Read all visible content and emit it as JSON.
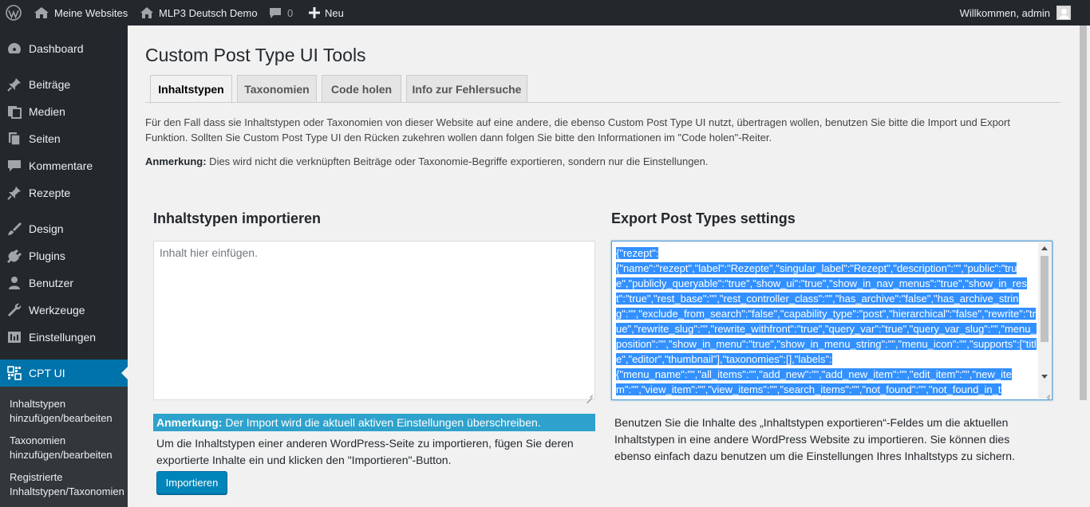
{
  "adminbar": {
    "my_sites": "Meine Websites",
    "site_name": "MLP3 Deutsch Demo",
    "comments_count": "0",
    "new_label": "Neu",
    "greeting": "Willkommen, admin"
  },
  "sidebar": {
    "items": [
      {
        "label": "Dashboard",
        "icon": "dashboard-icon"
      },
      {
        "label": "Beiträge",
        "icon": "pin-icon"
      },
      {
        "label": "Medien",
        "icon": "media-icon"
      },
      {
        "label": "Seiten",
        "icon": "pages-icon"
      },
      {
        "label": "Kommentare",
        "icon": "comment-icon"
      },
      {
        "label": "Rezepte",
        "icon": "pin-icon"
      },
      {
        "label": "Design",
        "icon": "brush-icon"
      },
      {
        "label": "Plugins",
        "icon": "plugin-icon"
      },
      {
        "label": "Benutzer",
        "icon": "user-icon"
      },
      {
        "label": "Werkzeuge",
        "icon": "wrench-icon"
      },
      {
        "label": "Einstellungen",
        "icon": "settings-icon"
      },
      {
        "label": "CPT UI",
        "icon": "grid-icon"
      }
    ],
    "submenu": [
      "Inhaltstypen hinzufügen/bearbeiten",
      "Taxonomien hinzufügen/bearbeiten",
      "Registrierte Inhaltstypen/Taxonomien"
    ]
  },
  "main": {
    "title": "Custom Post Type UI Tools",
    "tabs": [
      "Inhaltstypen",
      "Taxonomien",
      "Code holen",
      "Info zur Fehlersuche"
    ],
    "intro": "Für den Fall dass sie Inhaltstypen oder Taxonomien von dieser Website auf eine andere, die ebenso Custom Post Type UI nutzt, übertragen wollen, benutzen Sie bitte die Import und Export Funktion. Sollten Sie Custom Post Type UI den Rücken zukehren wollen dann folgen Sie bitte den Informationen im \"Code holen\"-Reiter.",
    "note_label": "Anmerkung:",
    "note_text": " Dies wird nicht die verknüpften Beiträge oder Taxonomie-Begriffe exportieren, sondern nur die Einstellungen.",
    "import": {
      "heading": "Inhaltstypen importieren",
      "placeholder": "Inhalt hier einfügen.",
      "warn_label": "Anmerkung:",
      "warn_text": " Der Import wird die aktuell aktiven Einstellungen überschreiben.",
      "description": "Um die Inhaltstypen einer anderen WordPress-Seite zu importieren, fügen Sie deren exportierte Inhalte ein und klicken den \"Importieren\"-Button.",
      "button": "Importieren"
    },
    "export": {
      "heading": "Export Post Types settings",
      "content": "{\"rezept\":\n{\"name\":\"rezept\",\"label\":\"Rezepte\",\"singular_label\":\"Rezept\",\"description\":\"\",\"public\":\"true\",\"publicly_queryable\":\"true\",\"show_ui\":\"true\",\"show_in_nav_menus\":\"true\",\"show_in_rest\":\"true\",\"rest_base\":\"\",\"rest_controller_class\":\"\",\"has_archive\":\"false\",\"has_archive_string\":\"\",\"exclude_from_search\":\"false\",\"capability_type\":\"post\",\"hierarchical\":\"false\",\"rewrite\":\"true\",\"rewrite_slug\":\"\",\"rewrite_withfront\":\"true\",\"query_var\":\"true\",\"query_var_slug\":\"\",\"menu_position\":\"\",\"show_in_menu\":\"true\",\"show_in_menu_string\":\"\",\"menu_icon\":\"\",\"supports\":[\"title\",\"editor\",\"thumbnail\"],\"taxonomies\":[],\"labels\":\n{\"menu_name\":\"\",\"all_items\":\"\",\"add_new\":\"\",\"add_new_item\":\"\",\"edit_item\":\"\",\"new_item\":\"\",\"view_item\":\"\",\"view_items\":\"\",\"search_items\":\"\",\"not_found\":\"\",\"not_found_in_t",
      "description": "Benutzen Sie die Inhalte des „Inhaltstypen exportieren“-Feldes um die aktuellen Inhaltstypen in eine andere WordPress Website zu importieren. Sie können dies ebenso einfach dazu benutzen um die Einstellungen Ihres Inhaltstyps zu sichern."
    }
  }
}
